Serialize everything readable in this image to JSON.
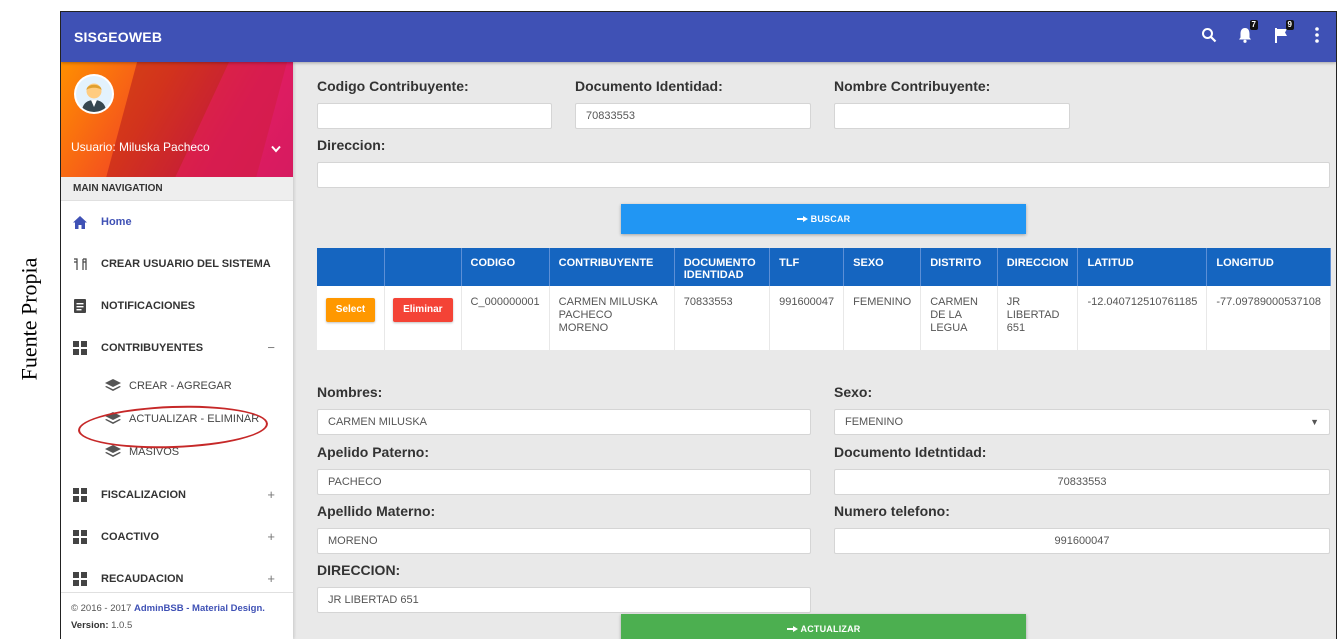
{
  "caption": "Fuente Propia",
  "app": {
    "brand": "SISGEOWEB",
    "notifications_count": "7",
    "flags_count": "9"
  },
  "user": {
    "label": "Usuario: Miluska Pacheco"
  },
  "sidebar": {
    "header": "MAIN NAVIGATION",
    "home": "Home",
    "items": [
      {
        "label": "CREAR USUARIO DEL SISTEMA",
        "icon": "people-icon"
      },
      {
        "label": "NOTIFICACIONES",
        "icon": "document-icon"
      },
      {
        "label": "CONTRIBUYENTES",
        "icon": "grid-icon",
        "toggle": "−"
      },
      {
        "label": "FISCALIZACION",
        "icon": "grid-icon",
        "toggle": "+"
      },
      {
        "label": "COACTIVO",
        "icon": "grid-icon",
        "toggle": "+"
      },
      {
        "label": "RECAUDACION",
        "icon": "grid-icon",
        "toggle": "+"
      }
    ],
    "sub_items": [
      "CREAR - AGREGAR",
      "ACTUALIZAR - ELIMINAR",
      "MASIVOS"
    ],
    "footer": {
      "copyright_prefix": "© 2016 - 2017 ",
      "copyright_link": "AdminBSB - Material Design.",
      "version_label": "Version:",
      "version_value": " 1.0.5"
    }
  },
  "search_form": {
    "codigo_label": "Codigo Contribuyente:",
    "codigo_value": "",
    "documento_label": "Documento Identidad:",
    "documento_value": "70833553",
    "nombre_label": "Nombre Contribuyente:",
    "nombre_value": "",
    "direccion_label": "Direccion:",
    "direccion_value": "",
    "buscar_button": "BUSCAR"
  },
  "table": {
    "headers": [
      "",
      "",
      "CODIGO",
      "CONTRIBUYENTE",
      "DOCUMENTO IDENTIDAD",
      "TLF",
      "SEXO",
      "DISTRITO",
      "DIRECCION",
      "LATITUD",
      "LONGITUD"
    ],
    "select_label": "Select",
    "delete_label": "Eliminar",
    "row": {
      "codigo": "C_000000001",
      "contribuyente": "CARMEN MILUSKA PACHECO MORENO",
      "documento": "70833553",
      "tlf": "991600047",
      "sexo": "FEMENINO",
      "distrito": "CARMEN DE LA LEGUA",
      "direccion": "JR LIBERTAD 651",
      "latitud": "-12.040712510761185",
      "longitud": "-77.09789000537108"
    }
  },
  "edit_form": {
    "nombres_label": "Nombres:",
    "nombres_value": "CARMEN MILUSKA",
    "sexo_label": "Sexo:",
    "sexo_value": "FEMENINO",
    "paterno_label": "Apelido Paterno:",
    "paterno_value": "PACHECO",
    "documento_label": "Documento Idetntidad:",
    "documento_value": "70833553",
    "materno_label": "Apellido Materno:",
    "materno_value": "MORENO",
    "telefono_label": "Numero telefono:",
    "telefono_value": "991600047",
    "direccion_label": "DIRECCION:",
    "direccion_value": "JR LIBERTAD 651",
    "actualizar_button": "ACTUALIZAR"
  },
  "colors": {
    "topbar": "#3f51b5",
    "table_header": "#1565c0",
    "buscar": "#2196f3",
    "actualizar": "#4caf50",
    "select": "#ff9800",
    "eliminar": "#f44336",
    "highlight": "#c62828"
  }
}
